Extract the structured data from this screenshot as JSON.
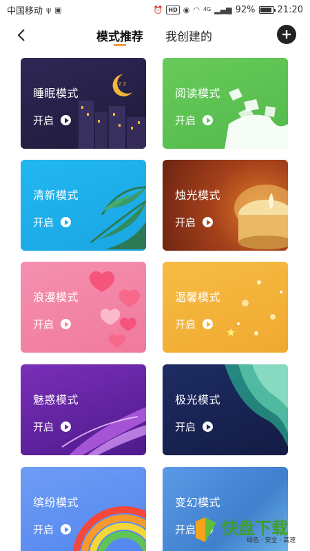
{
  "status_bar": {
    "carrier": "中国移动",
    "battery": "92%",
    "time": "21:20",
    "network": "4G",
    "hd": "HD"
  },
  "header": {
    "tabs": [
      {
        "label": "模式推荐",
        "active": true
      },
      {
        "label": "我创建的",
        "active": false
      }
    ]
  },
  "modes": [
    {
      "title": "睡眠模式",
      "action": "开启",
      "color": "#2a2248"
    },
    {
      "title": "阅读模式",
      "action": "开启",
      "color": "#5ec455"
    },
    {
      "title": "清新模式",
      "action": "开启",
      "color": "#1fb3ee"
    },
    {
      "title": "烛光模式",
      "action": "开启",
      "color": "#b34a1c"
    },
    {
      "title": "浪漫模式",
      "action": "开启",
      "color": "#f287a8"
    },
    {
      "title": "温馨模式",
      "action": "开启",
      "color": "#f3b13a"
    },
    {
      "title": "魅惑模式",
      "action": "开启",
      "color": "#6a2aa6"
    },
    {
      "title": "极光模式",
      "action": "开启",
      "color": "#18275a"
    },
    {
      "title": "缤纷模式",
      "action": "开启",
      "color": "#5a8ff0"
    },
    {
      "title": "变幻模式",
      "action": "开启",
      "color": "#4a8ed8"
    }
  ],
  "watermark": {
    "main": "快盘下载",
    "sub": "绿色 · 安全 · 高速"
  }
}
